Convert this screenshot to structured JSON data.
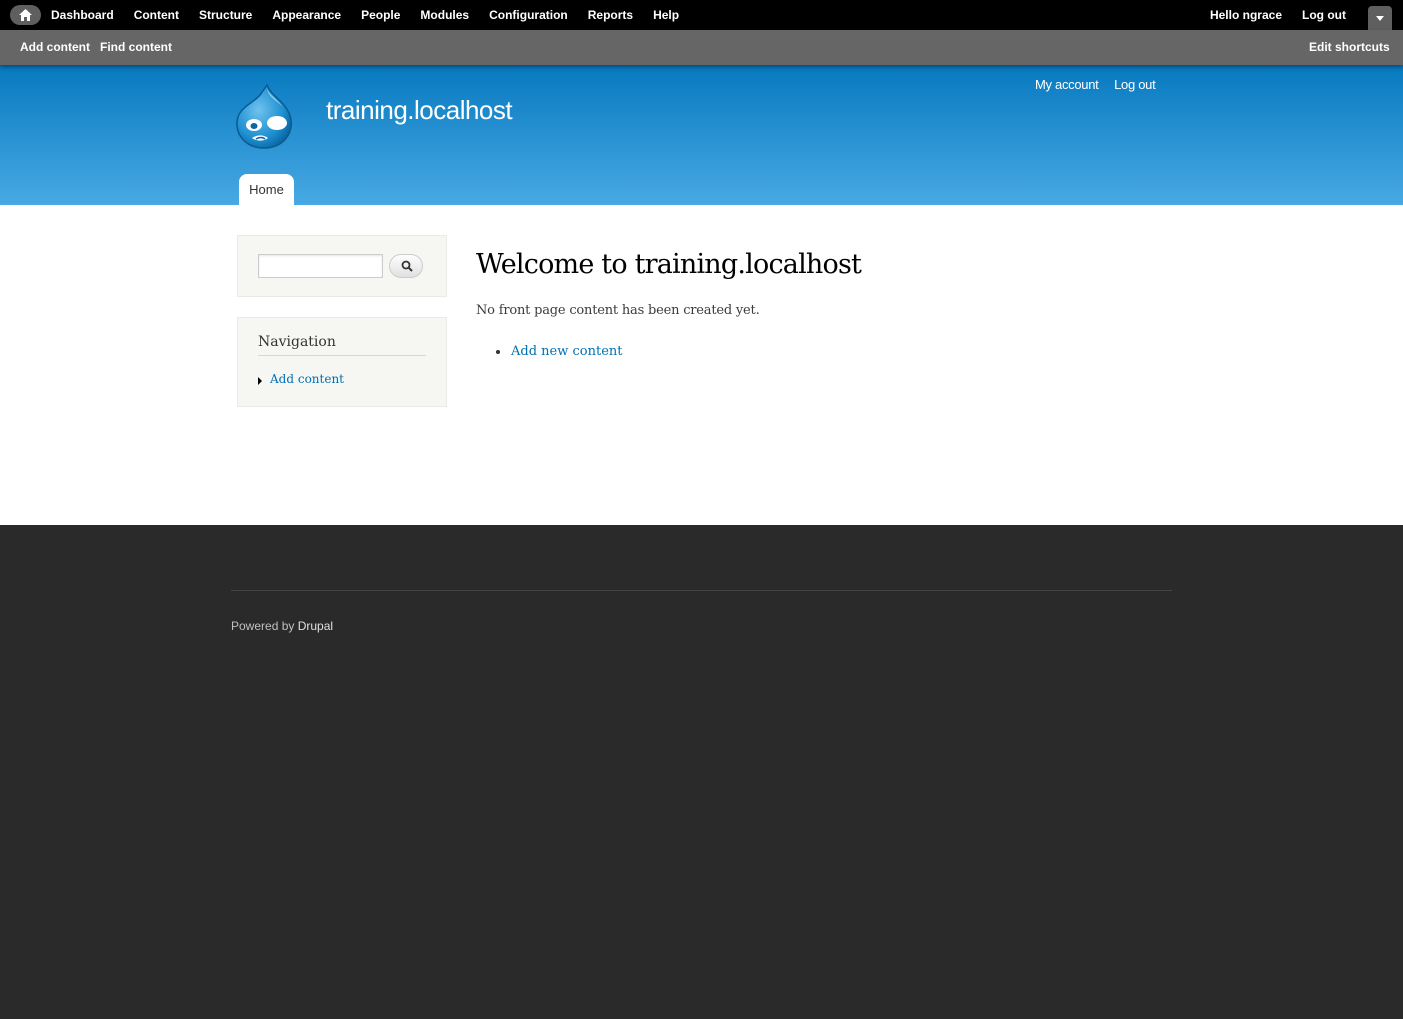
{
  "toolbar": {
    "menu": [
      "Dashboard",
      "Content",
      "Structure",
      "Appearance",
      "People",
      "Modules",
      "Configuration",
      "Reports",
      "Help"
    ],
    "hello": "Hello ",
    "username": "ngrace",
    "logout": "Log out"
  },
  "shortcuts": {
    "add_content": "Add content",
    "find_content": "Find content",
    "edit_shortcuts": "Edit shortcuts"
  },
  "header": {
    "site_name": "training.localhost",
    "secondary_menu": [
      "My account",
      "Log out"
    ],
    "primary_tab": "Home"
  },
  "sidebar": {
    "search_value": "",
    "navigation": {
      "title": "Navigation",
      "items": [
        "Add content"
      ]
    }
  },
  "main": {
    "title": "Welcome to training.localhost",
    "message": "No front page content has been created yet.",
    "links": [
      "Add new content"
    ]
  },
  "footer": {
    "powered_by": "Powered by ",
    "drupal_link": "Drupal"
  },
  "colors": {
    "header_top": "#0779bf",
    "header_bottom": "#48a9e4",
    "link": "#0071b3",
    "footer_bg": "#2a2a2a"
  }
}
